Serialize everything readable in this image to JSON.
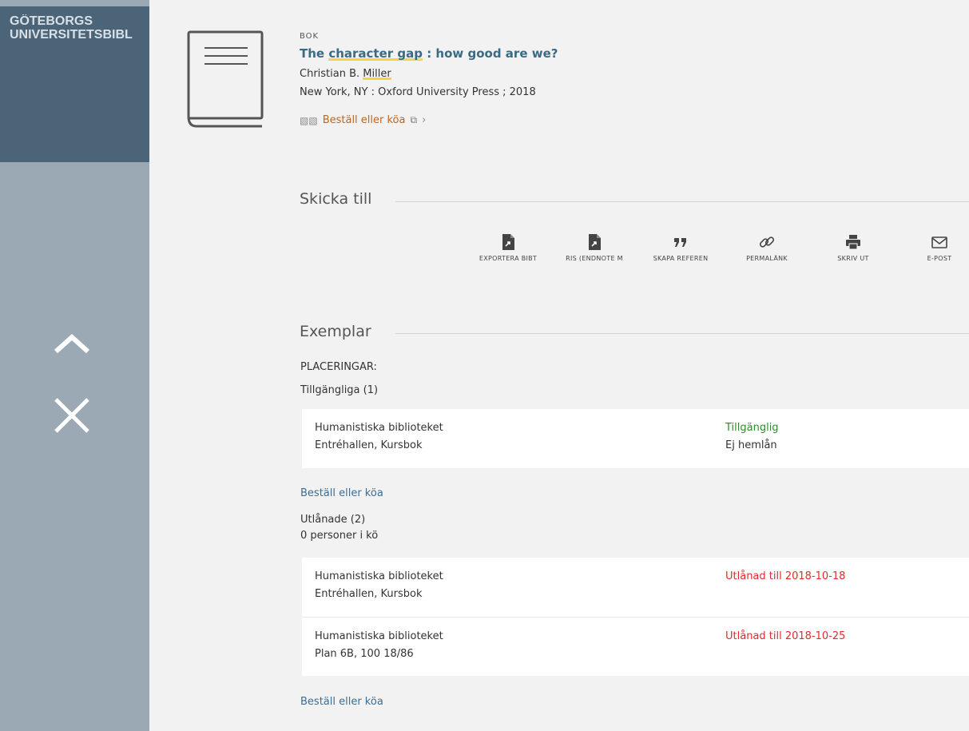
{
  "sidebar": {
    "logo_line1": "GÖTEBORGS",
    "logo_line2": "UNIVERSITETSBIBL",
    "up_icon": "chevron-up-icon",
    "close_icon": "close-icon"
  },
  "record": {
    "type": "BOK",
    "title_pre": "The ",
    "title_hl": "character gap",
    "title_post": " : how good are we?",
    "author_pre": "Christian B. ",
    "author_hl": "Miller",
    "publisher": "New York, NY : Oxford University Press ; 2018",
    "order_link": "Beställ eller köa"
  },
  "send_to": {
    "title": "Skicka till",
    "actions": [
      {
        "label": "EXPORTERA BIBT",
        "icon": "export-file-icon"
      },
      {
        "label": "RIS (ENDNOTE M",
        "icon": "export-file-icon"
      },
      {
        "label": "SKAPA REFEREN",
        "icon": "quote-icon"
      },
      {
        "label": "PERMALÄNK",
        "icon": "link-icon"
      },
      {
        "label": "SKRIV UT",
        "icon": "print-icon"
      },
      {
        "label": "E-POST",
        "icon": "email-icon"
      }
    ]
  },
  "items": {
    "title": "Exemplar",
    "locations_label": "PLACERINGAR:",
    "available_label": "Tillgängliga (1)",
    "available": [
      {
        "library": "Humanistiska biblioteket",
        "location": "Entréhallen, Kursbok",
        "status": "Tillgänglig",
        "note": "Ej hemlån"
      }
    ],
    "order_link_1": "Beställ eller köa",
    "loaned_label": "Utlånade (2)",
    "queue_label": "0 personer i kö",
    "loaned": [
      {
        "library": "Humanistiska biblioteket",
        "location": "Entréhallen, Kursbok",
        "status": "Utlånad till 2018-10-18"
      },
      {
        "library": "Humanistiska biblioteket",
        "location": "Plan 6B, 100 18/86",
        "status": "Utlånad till 2018-10-25"
      }
    ],
    "order_link_2": "Beställ eller köa"
  },
  "colors": {
    "sidebar": "#9aa9b3",
    "sidebar_top": "#4b6478",
    "title": "#3b6a84",
    "order": "#c0661e",
    "available": "#2e8b2e",
    "loaned": "#e22b2b",
    "link": "#3c6d91"
  }
}
